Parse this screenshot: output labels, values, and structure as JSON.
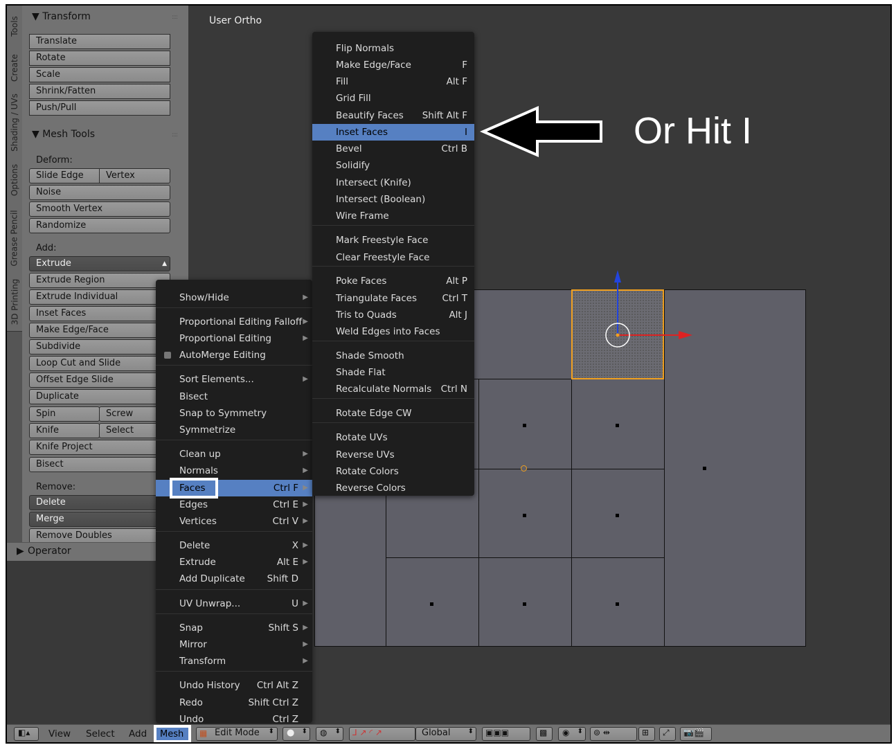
{
  "tabs": [
    "Tools",
    "Create",
    "Shading / UVs",
    "Options",
    "Grease Pencil",
    "3D Printing"
  ],
  "transform": {
    "title": "Transform",
    "buttons": [
      "Translate",
      "Rotate",
      "Scale",
      "Shrink/Fatten",
      "Push/Pull"
    ]
  },
  "mesh_tools": {
    "title": "Mesh Tools",
    "deform_label": "Deform:",
    "slide_edge": "Slide Edge",
    "vertex": "Vertex",
    "noise": "Noise",
    "smooth_vertex": "Smooth Vertex",
    "randomize": "Randomize",
    "add_label": "Add:",
    "extrude": "Extrude",
    "add_buttons": [
      "Extrude Region",
      "Extrude Individual",
      "Inset Faces",
      "Make Edge/Face",
      "Subdivide",
      "Loop Cut and Slide",
      "Offset Edge Slide",
      "Duplicate"
    ],
    "spin": "Spin",
    "screw": "Screw",
    "knife": "Knife",
    "select": "Select",
    "knife_project": "Knife Project",
    "bisect": "Bisect",
    "remove_label": "Remove:",
    "delete": "Delete",
    "merge": "Merge",
    "remove_doubles": "Remove Doubles"
  },
  "operator": "Operator",
  "viewport": {
    "label": "User Ortho"
  },
  "mesh_menu": {
    "items": [
      {
        "label": "Show/Hide",
        "shortcut": "",
        "submenu": true
      },
      {
        "label": "Proportional Editing Falloff",
        "shortcut": "",
        "submenu": true
      },
      {
        "label": "Proportional Editing",
        "shortcut": "",
        "submenu": true
      },
      {
        "label": "AutoMerge Editing",
        "shortcut": "",
        "submenu": false
      },
      {
        "label": "Sort Elements...",
        "shortcut": "",
        "submenu": true
      },
      {
        "label": "Bisect",
        "shortcut": "",
        "submenu": false
      },
      {
        "label": "Snap to Symmetry",
        "shortcut": "",
        "submenu": false
      },
      {
        "label": "Symmetrize",
        "shortcut": "",
        "submenu": false
      },
      {
        "label": "Clean up",
        "shortcut": "",
        "submenu": true
      },
      {
        "label": "Normals",
        "shortcut": "",
        "submenu": true
      },
      {
        "label": "Faces",
        "shortcut": "Ctrl F",
        "submenu": true
      },
      {
        "label": "Edges",
        "shortcut": "Ctrl E",
        "submenu": true
      },
      {
        "label": "Vertices",
        "shortcut": "Ctrl V",
        "submenu": true
      },
      {
        "label": "Delete",
        "shortcut": "X",
        "submenu": true
      },
      {
        "label": "Extrude",
        "shortcut": "Alt E",
        "submenu": true
      },
      {
        "label": "Add Duplicate",
        "shortcut": "Shift D",
        "submenu": false
      },
      {
        "label": "UV Unwrap...",
        "shortcut": "U",
        "submenu": true
      },
      {
        "label": "Snap",
        "shortcut": "Shift S",
        "submenu": true
      },
      {
        "label": "Mirror",
        "shortcut": "",
        "submenu": true
      },
      {
        "label": "Transform",
        "shortcut": "",
        "submenu": true
      },
      {
        "label": "Undo History",
        "shortcut": "Ctrl Alt Z",
        "submenu": false
      },
      {
        "label": "Redo",
        "shortcut": "Shift Ctrl Z",
        "submenu": false
      },
      {
        "label": "Undo",
        "shortcut": "Ctrl Z",
        "submenu": false
      }
    ]
  },
  "faces_menu": {
    "items": [
      {
        "label": "Flip Normals",
        "shortcut": ""
      },
      {
        "label": "Make Edge/Face",
        "shortcut": "F"
      },
      {
        "label": "Fill",
        "shortcut": "Alt F"
      },
      {
        "label": "Grid Fill",
        "shortcut": ""
      },
      {
        "label": "Beautify Faces",
        "shortcut": "Shift Alt F"
      },
      {
        "label": "Inset Faces",
        "shortcut": "I"
      },
      {
        "label": "Bevel",
        "shortcut": "Ctrl B"
      },
      {
        "label": "Solidify",
        "shortcut": ""
      },
      {
        "label": "Intersect (Knife)",
        "shortcut": ""
      },
      {
        "label": "Intersect (Boolean)",
        "shortcut": ""
      },
      {
        "label": "Wire Frame",
        "shortcut": ""
      },
      {
        "label": "Mark Freestyle Face",
        "shortcut": ""
      },
      {
        "label": "Clear Freestyle Face",
        "shortcut": ""
      },
      {
        "label": "Poke Faces",
        "shortcut": "Alt P"
      },
      {
        "label": "Triangulate Faces",
        "shortcut": "Ctrl T"
      },
      {
        "label": "Tris to Quads",
        "shortcut": "Alt J"
      },
      {
        "label": "Weld Edges into Faces",
        "shortcut": ""
      },
      {
        "label": "Shade Smooth",
        "shortcut": ""
      },
      {
        "label": "Shade Flat",
        "shortcut": ""
      },
      {
        "label": "Recalculate Normals",
        "shortcut": "Ctrl N"
      },
      {
        "label": "Rotate Edge CW",
        "shortcut": ""
      },
      {
        "label": "Rotate UVs",
        "shortcut": ""
      },
      {
        "label": "Reverse UVs",
        "shortcut": ""
      },
      {
        "label": "Rotate Colors",
        "shortcut": ""
      },
      {
        "label": "Reverse Colors",
        "shortcut": ""
      }
    ]
  },
  "annotation": "Or Hit I",
  "header": {
    "view": "View",
    "select": "Select",
    "add": "Add",
    "mesh": "Mesh",
    "mode": "Edit Mode",
    "orientation": "Global"
  },
  "colors": {
    "highlight": "#5680c2",
    "selected_edge": "#f0a020",
    "menu_bg": "#1e1e1e"
  }
}
